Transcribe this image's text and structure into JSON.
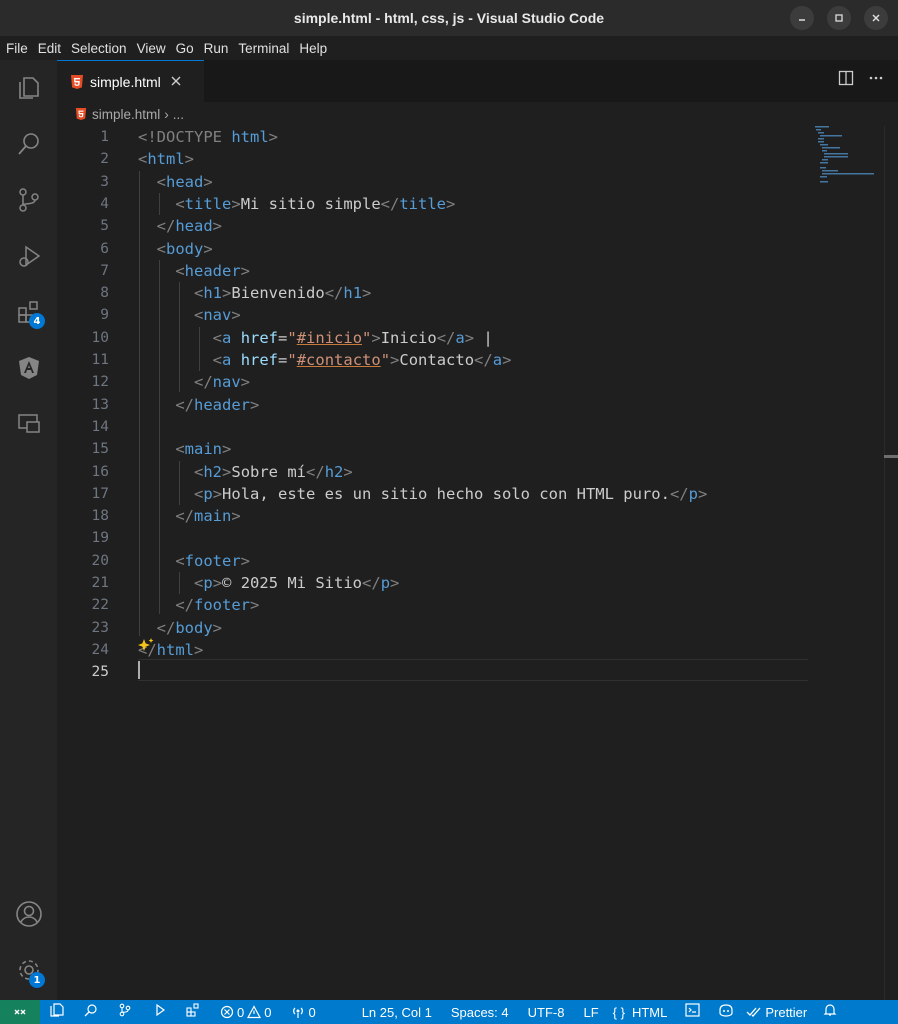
{
  "window": {
    "title": "simple.html - html, css, js - Visual Studio Code"
  },
  "menu": [
    "File",
    "Edit",
    "Selection",
    "View",
    "Go",
    "Run",
    "Terminal",
    "Help"
  ],
  "activity": {
    "extensions_badge": "4",
    "settings_badge": "1"
  },
  "tab": {
    "label": "simple.html"
  },
  "breadcrumb": {
    "file": "simple.html",
    "sep": "›",
    "more": "..."
  },
  "line_numbers": [
    "1",
    "2",
    "3",
    "4",
    "5",
    "6",
    "7",
    "8",
    "9",
    "10",
    "11",
    "12",
    "13",
    "14",
    "15",
    "16",
    "17",
    "18",
    "19",
    "20",
    "21",
    "22",
    "23",
    "24",
    "25"
  ],
  "code": {
    "l1": {
      "open": "<!DOCTYPE",
      "kw": "html",
      "close": ">"
    },
    "l2": {
      "tag": "html"
    },
    "l3": {
      "tag": "head"
    },
    "l4": {
      "tag": "title",
      "text": "Mi sitio simple"
    },
    "l5": {
      "tag": "head"
    },
    "l6": {
      "tag": "body"
    },
    "l7": {
      "tag": "header"
    },
    "l8": {
      "tag": "h1",
      "text": "Bienvenido"
    },
    "l9": {
      "tag": "nav"
    },
    "l10": {
      "tag": "a",
      "attr": "href",
      "value": "#inicio",
      "text": "Inicio",
      "after": " |"
    },
    "l11": {
      "tag": "a",
      "attr": "href",
      "value": "#contacto",
      "text": "Contacto"
    },
    "l12": {
      "tag": "nav"
    },
    "l13": {
      "tag": "header"
    },
    "l15": {
      "tag": "main"
    },
    "l16": {
      "tag": "h2",
      "text": "Sobre mí"
    },
    "l17": {
      "tag": "p",
      "text": "Hola, este es un sitio hecho solo con HTML puro."
    },
    "l18": {
      "tag": "main"
    },
    "l20": {
      "tag": "footer"
    },
    "l21": {
      "tag": "p",
      "text": "© 2025 Mi Sitio"
    },
    "l22": {
      "tag": "footer"
    },
    "l23": {
      "tag": "body"
    },
    "l24": {
      "tag": "html"
    }
  },
  "status": {
    "errors": "0",
    "warnings": "0",
    "ports": "0",
    "position": "Ln 25, Col 1",
    "spaces": "Spaces: 4",
    "encoding": "UTF-8",
    "eol": "LF",
    "language_icon": "{ }",
    "language": "HTML",
    "prettier": "Prettier"
  },
  "colors": {
    "accent": "#0078d4",
    "status": "#007acc",
    "remote": "#16825d",
    "tag": "#569cd6",
    "attr": "#9cdcfe",
    "string": "#ce9178"
  }
}
